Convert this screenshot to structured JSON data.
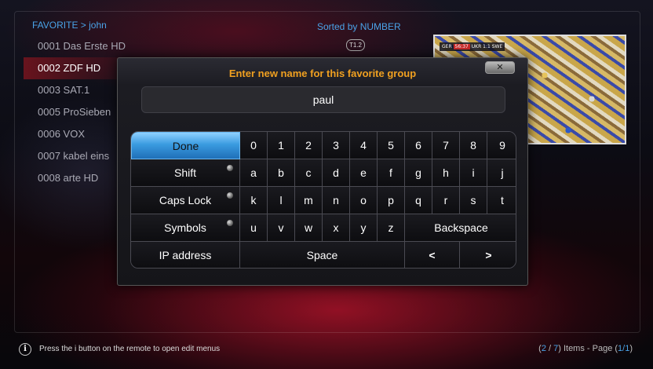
{
  "header": {
    "breadcrumb": "FAVORITE > john",
    "sorted_label": "Sorted by NUMBER",
    "channel_badge": "T1.2"
  },
  "channels": [
    {
      "label": "0001 Das Erste HD",
      "active": false
    },
    {
      "label": "0002 ZDF HD",
      "active": true
    },
    {
      "label": "0003 SAT.1",
      "active": false
    },
    {
      "label": "0005 ProSieben",
      "active": false
    },
    {
      "label": "0006 VOX",
      "active": false
    },
    {
      "label": "0007 kabel eins",
      "active": false
    },
    {
      "label": "0008 arte HD",
      "active": false
    }
  ],
  "preview": {
    "score_left": "GER",
    "score_time": "56:37",
    "score_right": "UKR 1:1 SWE"
  },
  "dialog": {
    "title": "Enter new name for this favorite group",
    "close_icon": "close-icon",
    "input_value": "paul"
  },
  "keyboard": {
    "done": "Done",
    "shift": "Shift",
    "caps_lock": "Caps Lock",
    "symbols": "Symbols",
    "ip_address": "IP address",
    "backspace": "Backspace",
    "space": "Space",
    "left": "<",
    "right": ">",
    "row1": [
      "0",
      "1",
      "2",
      "3",
      "4",
      "5",
      "6",
      "7",
      "8",
      "9"
    ],
    "row2": [
      "a",
      "b",
      "c",
      "d",
      "e",
      "f",
      "g",
      "h",
      "i",
      "j"
    ],
    "row3": [
      "k",
      "l",
      "m",
      "n",
      "o",
      "p",
      "q",
      "r",
      "s",
      "t"
    ],
    "row4": [
      "u",
      "v",
      "w",
      "x",
      "y",
      "z"
    ]
  },
  "footer": {
    "info_icon": "info-icon",
    "hint": "Press the i button on the remote to open edit menus",
    "pager_open": "(",
    "current": "2",
    "sep": " / ",
    "total": "7",
    "pager_mid": ") Items - Page (",
    "page": "1/1",
    "pager_close": ")"
  },
  "colors": {
    "accent": "#4aa3e8",
    "title": "#f0a020",
    "selected_key": "#3a9be0"
  }
}
